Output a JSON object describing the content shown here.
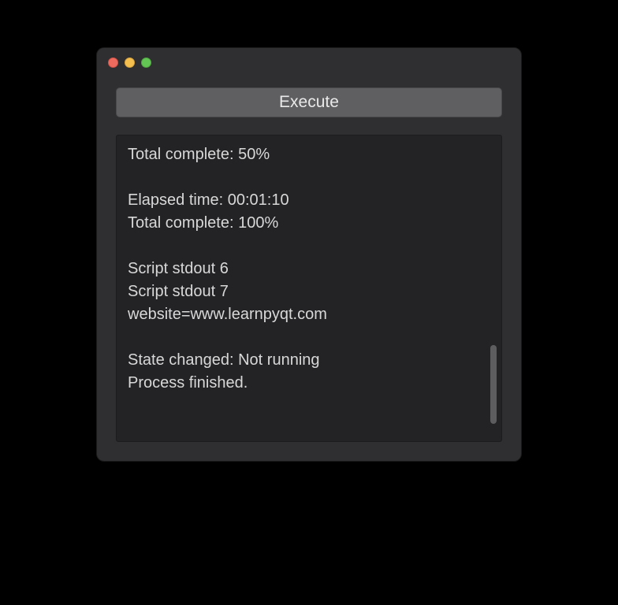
{
  "window": {
    "traffic": {
      "close": "close",
      "minimize": "minimize",
      "maximize": "maximize"
    }
  },
  "toolbar": {
    "execute_label": "Execute"
  },
  "output": {
    "lines": [
      "Total complete: 50%",
      "",
      "Elapsed time: 00:01:10",
      "Total complete: 100%",
      "",
      "Script stdout 6",
      "Script stdout 7",
      "website=www.learnpyqt.com",
      "",
      "State changed: Not running",
      "Process finished."
    ]
  }
}
